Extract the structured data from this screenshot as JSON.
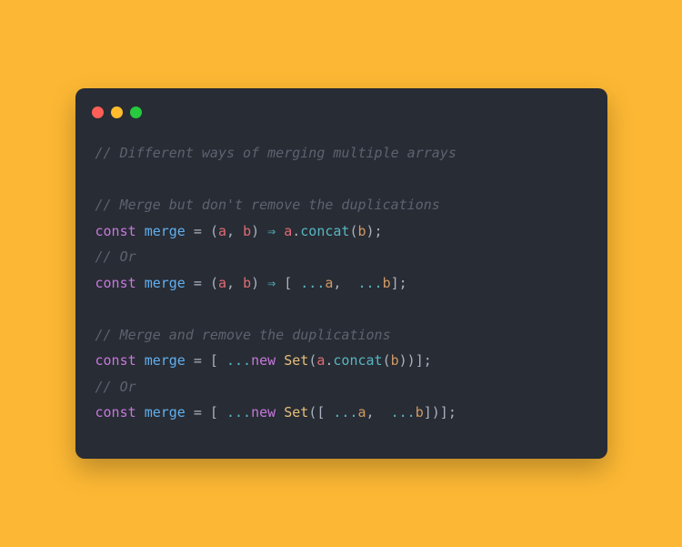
{
  "titlebar": {
    "red": "close",
    "yellow": "minimize",
    "green": "zoom"
  },
  "code": {
    "comment1": "// Different ways of merging multiple arrays",
    "comment2": "// Merge but don't remove the duplications",
    "line1": {
      "const": "const",
      "name": "merge",
      "eq": " = ",
      "lparen": "(",
      "a": "a",
      "comma": ", ",
      "b": "b",
      "rparen": ") ",
      "arrow": "⇒",
      "sp": " ",
      "obj": "a",
      "dot": ".",
      "method": "concat",
      "lp2": "(",
      "arg": "b",
      "rp2": ");"
    },
    "comment_or1": "// Or",
    "line2": {
      "const": "const",
      "name": "merge",
      "eq": " = ",
      "lparen": "(",
      "a": "a",
      "comma": ", ",
      "b": "b",
      "rparen": ") ",
      "arrow": "⇒",
      "sp": " [",
      "spread1": " ...",
      "ax": "a",
      "comma2": ", ",
      "spread2": " ...",
      "bx": "b",
      "end": "];"
    },
    "comment3": "// Merge and remove the duplications",
    "line3": {
      "const": "const",
      "name": "merge",
      "eq": " = [",
      "spread": " ...",
      "new": "new",
      "sp": " ",
      "cls": "Set",
      "lp": "(",
      "a": "a",
      "dot": ".",
      "method": "concat",
      "lp2": "(",
      "b": "b",
      "rp2": "))];"
    },
    "comment_or2": "// Or",
    "line4": {
      "const": "const",
      "name": "merge",
      "eq": " = [",
      "spread": " ...",
      "new": "new",
      "sp": " ",
      "cls": "Set",
      "lp": "([",
      "spread1": " ...",
      "a": "a",
      "comma": ", ",
      "spread2": " ...",
      "b": "b",
      "end": "])];"
    }
  }
}
